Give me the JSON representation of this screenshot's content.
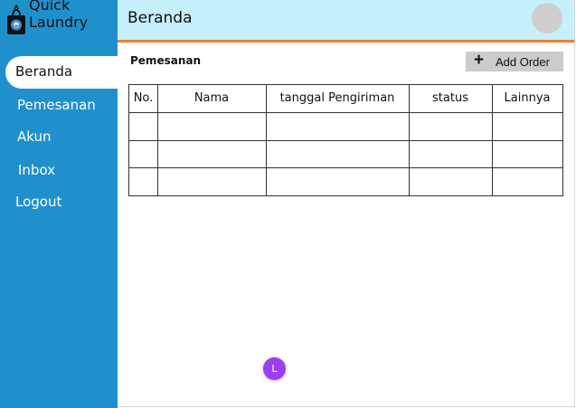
{
  "app": {
    "logo_line1": "Quick",
    "logo_line2": "Laundry"
  },
  "sidebar": {
    "items": [
      {
        "label": "Beranda",
        "active": true
      },
      {
        "label": "Pemesanan"
      },
      {
        "label": "Akun"
      },
      {
        "label": "Inbox"
      },
      {
        "label": "Logout"
      }
    ]
  },
  "header": {
    "title": "Beranda"
  },
  "main": {
    "section_title": "Pemesanan",
    "add_button_label": "Add Order",
    "table": {
      "columns": [
        "No.",
        "Nama",
        "tanggal Pengiriman",
        "status",
        "Lainnya"
      ]
    }
  },
  "user": {
    "initial": "L",
    "avatar_color": "#9b3ff0"
  },
  "colors": {
    "sidebar_bg": "#2090cc",
    "header_bg": "#c6f0fc",
    "header_accent": "#f07f2f"
  }
}
